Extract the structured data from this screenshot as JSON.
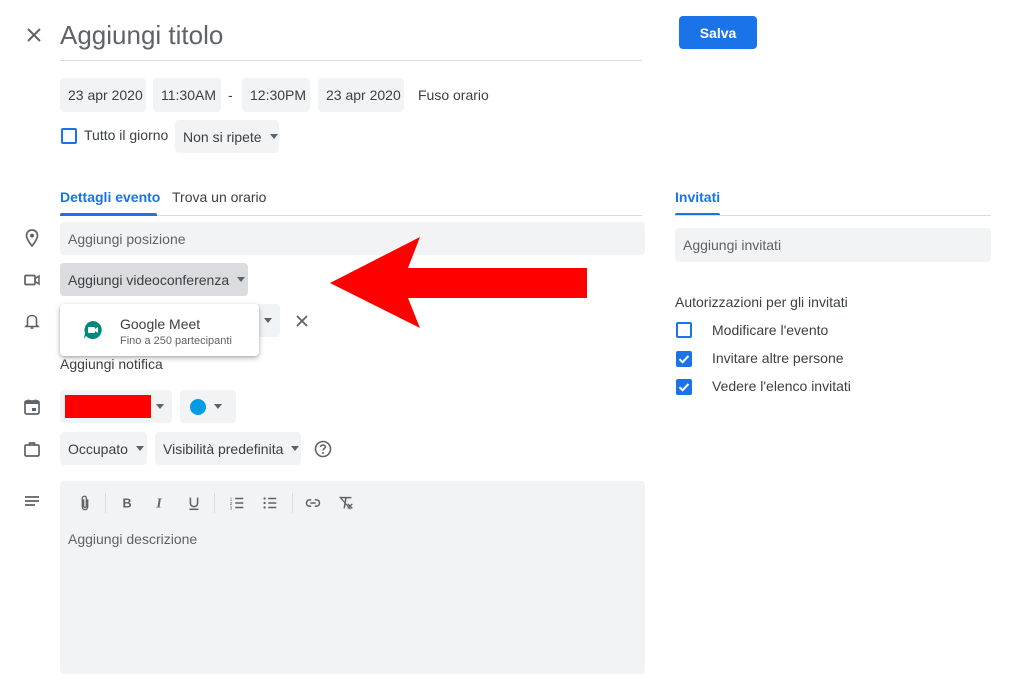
{
  "header": {
    "title_placeholder": "Aggiungi titolo",
    "save_label": "Salva"
  },
  "datetime": {
    "start_date": "23 apr 2020",
    "start_time": "11:30AM",
    "separator": "-",
    "end_time": "12:30PM",
    "end_date": "23 apr 2020",
    "timezone": "Fuso orario",
    "all_day_label": "Tutto il giorno",
    "repeat": "Non si ripete"
  },
  "tabs": {
    "details": "Dettagli evento",
    "find_time": "Trova un orario",
    "guests": "Invitati"
  },
  "details": {
    "location_placeholder": "Aggiungi posizione",
    "videoconference_label": "Aggiungi videoconferenza",
    "meet_title": "Google Meet",
    "meet_subtitle": "Fino a 250 partecipanti",
    "add_notification": "Aggiungi notifica",
    "availability": "Occupato",
    "visibility": "Visibilità predefinita",
    "description_placeholder": "Aggiungi descrizione"
  },
  "guests": {
    "add_placeholder": "Aggiungi invitati",
    "permissions_title": "Autorizzazioni per gli invitati",
    "permissions": [
      {
        "label": "Modificare l'evento",
        "checked": false
      },
      {
        "label": "Invitare altre persone",
        "checked": true
      },
      {
        "label": "Vedere l'elenco invitati",
        "checked": true
      }
    ]
  },
  "colors": {
    "accent": "#1a73e8",
    "calendar_redaction": "#ff0000",
    "event_color_dot": "#039be5",
    "annotation_arrow": "#ff0000",
    "meet_green": "#00897b"
  }
}
